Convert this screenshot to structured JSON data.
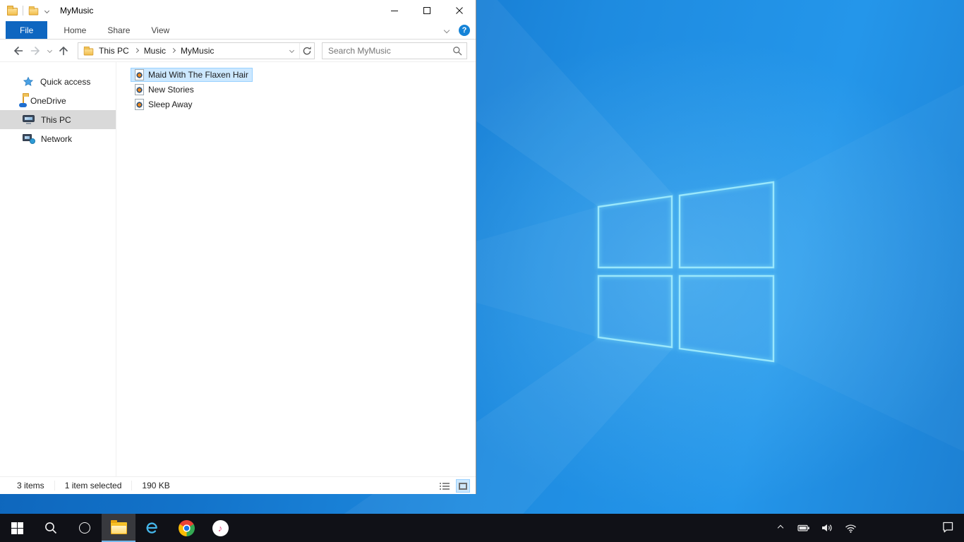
{
  "explorer": {
    "title": "MyMusic",
    "ribbon": {
      "tabs": [
        "File",
        "Home",
        "Share",
        "View"
      ],
      "help_glyph": "?"
    },
    "address": {
      "breadcrumb": [
        "This PC",
        "Music",
        "MyMusic"
      ]
    },
    "search": {
      "placeholder": "Search MyMusic"
    },
    "sidebar": {
      "items": [
        {
          "label": "Quick access",
          "icon": "quick-access-star-icon",
          "selected": false
        },
        {
          "label": "OneDrive",
          "icon": "onedrive-folder-icon",
          "selected": false
        },
        {
          "label": "This PC",
          "icon": "computer-icon",
          "selected": true
        },
        {
          "label": "Network",
          "icon": "network-icon",
          "selected": false
        }
      ]
    },
    "files": [
      {
        "name": "Maid With The Flaxen Hair",
        "icon": "media-file-icon",
        "selected": true
      },
      {
        "name": "New Stories",
        "icon": "media-file-icon",
        "selected": false
      },
      {
        "name": "Sleep Away",
        "icon": "media-file-icon",
        "selected": false
      }
    ],
    "statusbar": {
      "count": "3 items",
      "selected": "1 item selected",
      "size": "190 KB"
    },
    "titlebar_icons": [
      "folder-icon",
      "new-folder-icon",
      "qat-chevron-icon"
    ],
    "window_control_icons": [
      "minimize-icon",
      "maximize-icon",
      "close-icon"
    ]
  },
  "taskbar": {
    "buttons": [
      "start",
      "search",
      "cortana",
      "file-explorer",
      "internet-explorer",
      "chrome",
      "itunes"
    ],
    "active_button": "file-explorer",
    "tray_icons": [
      "hidden-icons-chevron",
      "battery",
      "volume",
      "network",
      "action-center"
    ]
  },
  "colors": {
    "accent": "#0078d7",
    "file_tab": "#0e66c0",
    "selection_fill": "#cce8ff",
    "selection_border": "#99d1ff",
    "sidebar_selected": "#d9d9d9",
    "taskbar_bg": "#101117"
  }
}
